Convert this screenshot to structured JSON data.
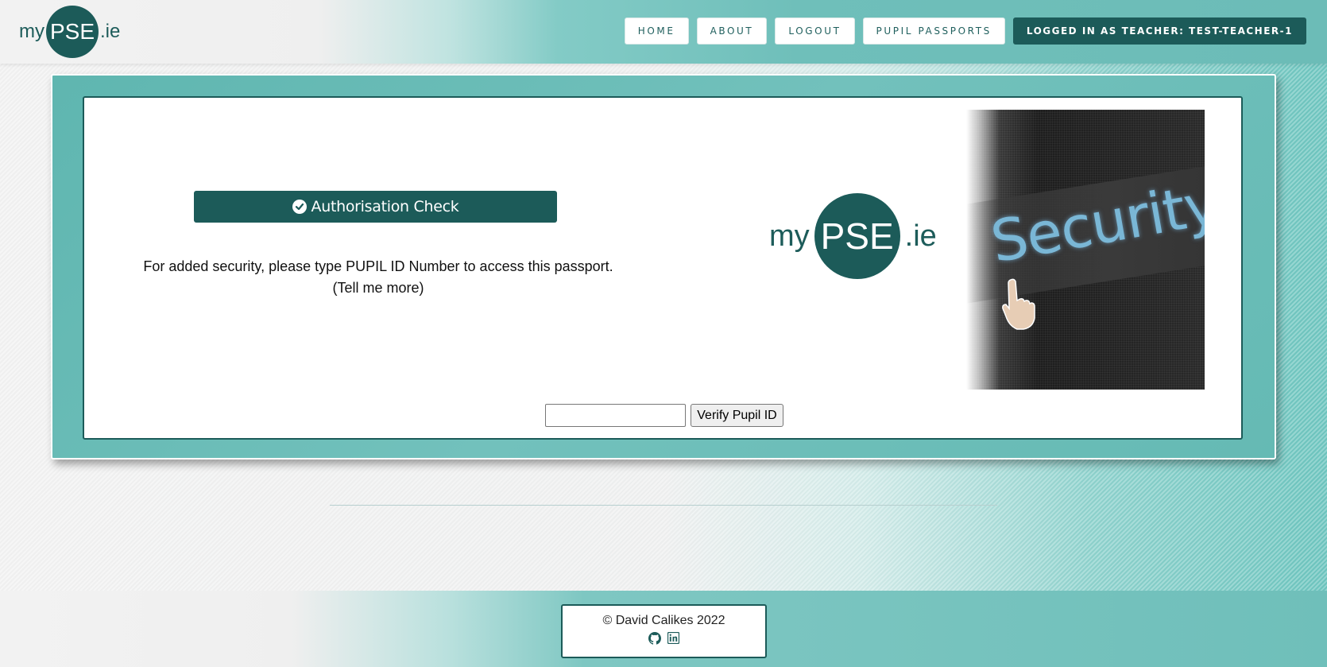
{
  "header": {
    "logo": {
      "my": "my",
      "pse": "PSE",
      "ie": ".ie"
    },
    "nav": [
      {
        "label": "HOME"
      },
      {
        "label": "ABOUT"
      },
      {
        "label": "LOGOUT"
      },
      {
        "label": "PUPIL PASSPORTS"
      }
    ],
    "logged_in": "LOGGED IN AS TEACHER: TEST-TEACHER-1"
  },
  "main": {
    "auth_title": "Authorisation Check",
    "info_line1": "For added security, please type PUPIL ID Number to access this passport.",
    "info_line2": "(Tell me more)",
    "logo": {
      "my": "my",
      "pse": "PSE",
      "ie": ".ie"
    },
    "security_image_text": "Security",
    "pupil_id": {
      "value": "",
      "placeholder": ""
    },
    "verify_label": "Verify Pupil ID"
  },
  "footer": {
    "copyright": "© David Calikes 2022",
    "icons": [
      "github-icon",
      "linkedin-icon"
    ]
  },
  "colors": {
    "brand_dark": "#1c5b59",
    "teal": "#6cbcb7"
  }
}
